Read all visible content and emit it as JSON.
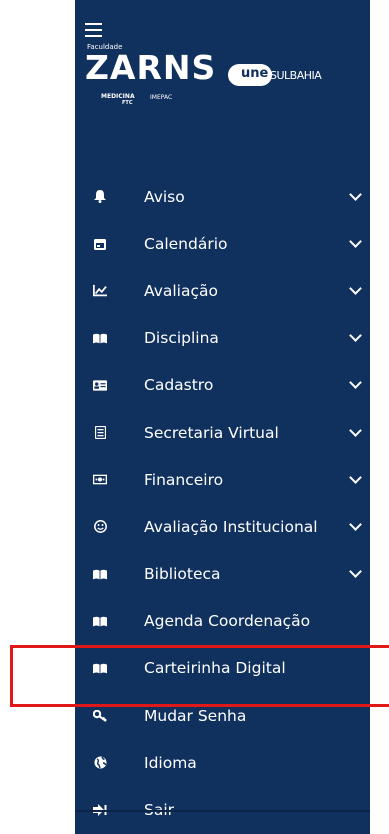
{
  "brand": {
    "faculdade": "Faculdade",
    "zarns": "ZARNS",
    "medicina": "MEDICINA",
    "ftc": "FTC",
    "imepac": "IMEPAC",
    "une": "une",
    "sulbahia": "SULBAHIA"
  },
  "colors": {
    "sidebar_bg": "#10305e",
    "highlight": "#e01818"
  },
  "menu": {
    "items": [
      {
        "label": "Aviso",
        "icon": "bell-icon",
        "expandable": true
      },
      {
        "label": "Calendário",
        "icon": "calendar-icon",
        "expandable": true
      },
      {
        "label": "Avaliação",
        "icon": "chart-line-icon",
        "expandable": true
      },
      {
        "label": "Disciplina",
        "icon": "book-open-icon",
        "expandable": true
      },
      {
        "label": "Cadastro",
        "icon": "id-card-icon",
        "expandable": true
      },
      {
        "label": "Secretaria Virtual",
        "icon": "document-icon",
        "expandable": true
      },
      {
        "label": "Financeiro",
        "icon": "money-icon",
        "expandable": true
      },
      {
        "label": "Avaliação Institucional",
        "icon": "smile-icon",
        "expandable": true
      },
      {
        "label": "Biblioteca",
        "icon": "book-open-icon",
        "expandable": true
      },
      {
        "label": "Agenda Coordenação",
        "icon": "book-open-icon",
        "expandable": false
      },
      {
        "label": "Carteirinha Digital",
        "icon": "book-open-icon",
        "expandable": false
      },
      {
        "label": "Mudar Senha",
        "icon": "key-icon",
        "expandable": false
      },
      {
        "label": "Idioma",
        "icon": "globe-icon",
        "expandable": false
      },
      {
        "label": "Sair",
        "icon": "sign-out-icon",
        "expandable": false
      }
    ]
  }
}
